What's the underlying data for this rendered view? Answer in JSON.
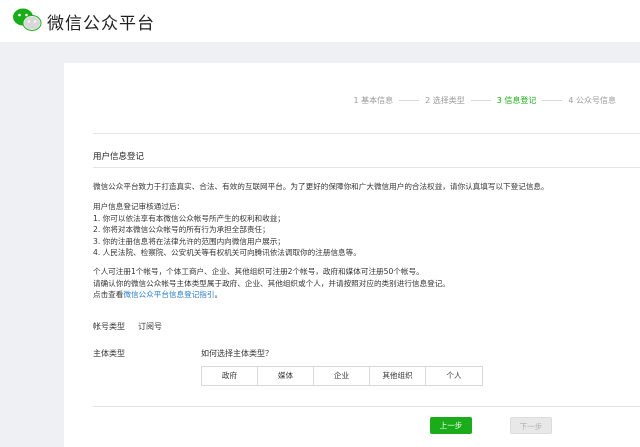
{
  "header": {
    "brand": "微信公众平台"
  },
  "steps": [
    {
      "label": "1 基本信息",
      "state": "done"
    },
    {
      "label": "2 选择类型",
      "state": "done"
    },
    {
      "label": "3 信息登记",
      "state": "active"
    },
    {
      "label": "4 公众号信息",
      "state": "todo"
    }
  ],
  "section": {
    "title": "用户信息登记"
  },
  "intro": "微信公众平台致力于打造真实、合法、有效的互联网平台。为了更好的保障你和广大微信用户的合法权益，请你认真填写以下登记信息。",
  "review": {
    "heading": "用户信息登记审核通过后：",
    "items": [
      "1. 你可以依法享有本微信公众帐号所产生的权利和收益；",
      "2. 你将对本微信公众帐号的所有行为承担全部责任；",
      "3. 你的注册信息将在法律允许的范围内向微信用户展示；",
      "4. 人民法院、检察院、公安机关等有权机关可向腾讯依法调取你的注册信息等。"
    ]
  },
  "notes": {
    "line1": "个人可注册1个帐号，个体工商户、企业、其他组织可注册2个帐号，政府和媒体可注册50个帐号。",
    "line2": "请确认你的微信公众帐号主体类型属于政府、企业、其他组织或个人，并请按照对应的类别进行信息登记。",
    "line3_prefix": "点击查看",
    "line3_link": "微信公众平台信息登记指引",
    "line3_suffix": "。"
  },
  "form": {
    "account_type_label": "帐号类型",
    "account_type_value": "订阅号",
    "subject_type_label": "主体类型",
    "subject_help_link": "如何选择主体类型？",
    "subject_options": [
      "政府",
      "媒体",
      "企业",
      "其他组织",
      "个人"
    ]
  },
  "buttons": {
    "prev": "上一步",
    "next": "下一步"
  },
  "colors": {
    "accent": "#1aad19",
    "link": "#2b7dc6"
  }
}
